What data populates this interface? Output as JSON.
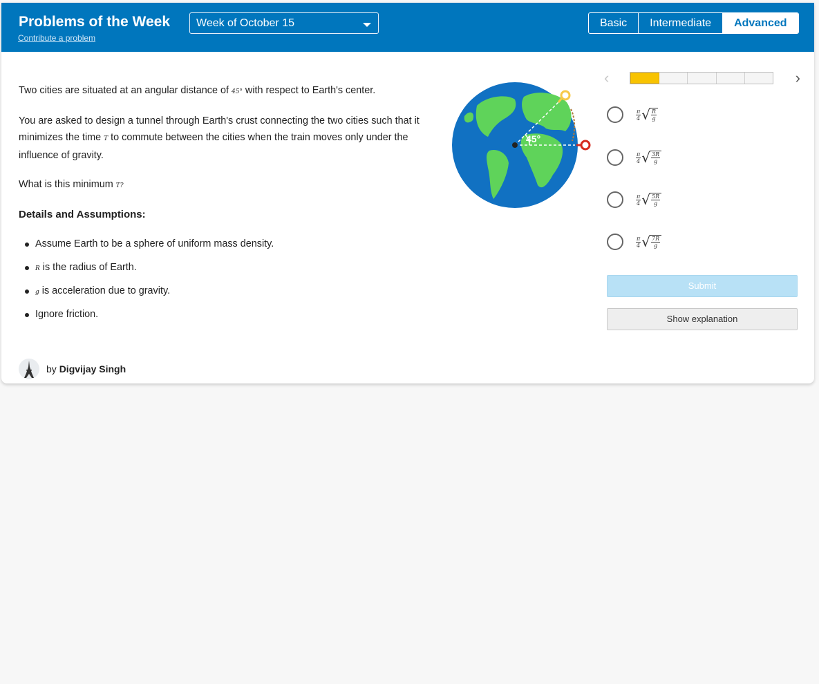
{
  "header": {
    "title": "Problems of the Week",
    "contribute": "Contribute a problem",
    "week": "Week of October 15",
    "levels": [
      {
        "label": "Basic"
      },
      {
        "label": "Intermediate"
      },
      {
        "label": "Advanced",
        "active": true
      }
    ]
  },
  "problem": {
    "p1_before": "Two cities are situated at an angular distance of ",
    "p1_angle": "45°",
    "p1_after": " with respect to Earth's center.",
    "p2_before": "You are asked to design a tunnel through Earth's crust connecting the two cities such that it minimizes the time ",
    "p2_var": "T",
    "p2_after": " to commute between the cities when the train moves only under the influence of gravity.",
    "p3_before": "What is this minimum ",
    "p3_var": "T?",
    "details_heading": "Details and Assumptions:",
    "b1": "Assume Earth to be a sphere of uniform mass density.",
    "b2_var": "R",
    "b2_text": " is the radius of Earth.",
    "b3_var": "g",
    "b3_text": " is acceleration due to gravity.",
    "b4": "Ignore friction."
  },
  "figure": {
    "angle_label": "45°",
    "colors": {
      "ocean": "#1171c2",
      "land": "#5fd35a",
      "city_a": "#f7c948",
      "city_b": "#d62b1f"
    }
  },
  "quiz": {
    "progress": {
      "current": 1,
      "total": 5
    },
    "prev_icon": "chevron-left-icon",
    "next_icon": "chevron-right-icon",
    "choices": [
      {
        "pi": "π",
        "four": "4",
        "top": "R",
        "bottom": "g"
      },
      {
        "pi": "π",
        "four": "4",
        "top": "3R",
        "bottom": "g"
      },
      {
        "pi": "π",
        "four": "4",
        "top": "5R",
        "bottom": "g"
      },
      {
        "pi": "π",
        "four": "4",
        "top": "7R",
        "bottom": "g"
      }
    ],
    "submit": "Submit",
    "explain": "Show explanation"
  },
  "author": {
    "by": "by ",
    "name": "Digvijay Singh"
  }
}
